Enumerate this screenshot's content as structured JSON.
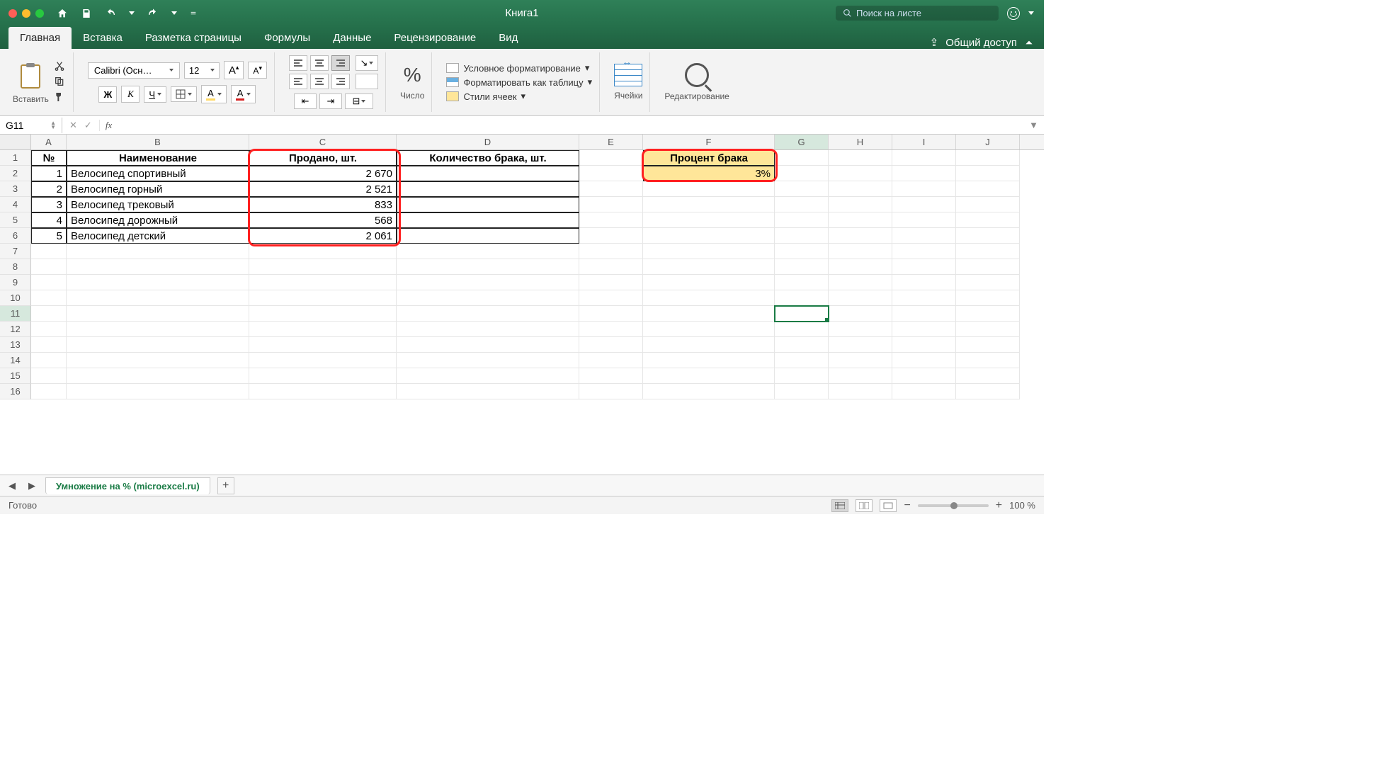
{
  "title": "Книга1",
  "search_placeholder": "Поиск на листе",
  "tabs": {
    "main": "Главная",
    "insert": "Вставка",
    "layout": "Разметка страницы",
    "formulas": "Формулы",
    "data": "Данные",
    "review": "Рецензирование",
    "view": "Вид"
  },
  "share": "Общий доступ",
  "ribbon": {
    "paste": "Вставить",
    "font_name": "Calibri (Осн…",
    "font_size": "12",
    "bigA": "A",
    "smallA": "A",
    "bold": "Ж",
    "italic": "К",
    "underline": "Ч",
    "fillA": "A",
    "colorA": "A",
    "number_label": "Число",
    "cond_format": "Условное форматирование",
    "format_table": "Форматировать как таблицу",
    "cell_styles": "Стили ячеек",
    "cells": "Ячейки",
    "editing": "Редактирование",
    "pct": "%"
  },
  "namebox": "G11",
  "columns": [
    "A",
    "B",
    "C",
    "D",
    "E",
    "F",
    "G",
    "H",
    "I",
    "J"
  ],
  "row_numbers": [
    "1",
    "2",
    "3",
    "4",
    "5",
    "6",
    "7",
    "8",
    "9",
    "10",
    "11",
    "12",
    "13",
    "14",
    "15",
    "16"
  ],
  "headers": {
    "num": "№",
    "name": "Наименование",
    "sold": "Продано, шт.",
    "defect_qty": "Количество брака, шт.",
    "defect_pct": "Процент брака"
  },
  "rows": [
    {
      "n": "1",
      "name": "Велосипед спортивный",
      "sold": "2 670"
    },
    {
      "n": "2",
      "name": "Велосипед горный",
      "sold": "2 521"
    },
    {
      "n": "3",
      "name": "Велосипед трековый",
      "sold": "833"
    },
    {
      "n": "4",
      "name": "Велосипед дорожный",
      "sold": "568"
    },
    {
      "n": "5",
      "name": "Велосипед детский",
      "sold": "2 061"
    }
  ],
  "defect_pct_value": "3%",
  "sheet_name": "Умножение на % (microexcel.ru)",
  "status_ready": "Готово",
  "zoom": "100 %",
  "fx": "fx",
  "plus": "+",
  "minus": "−",
  "ab": "ab",
  "arrow": "↘",
  "share_icon": "⇪"
}
